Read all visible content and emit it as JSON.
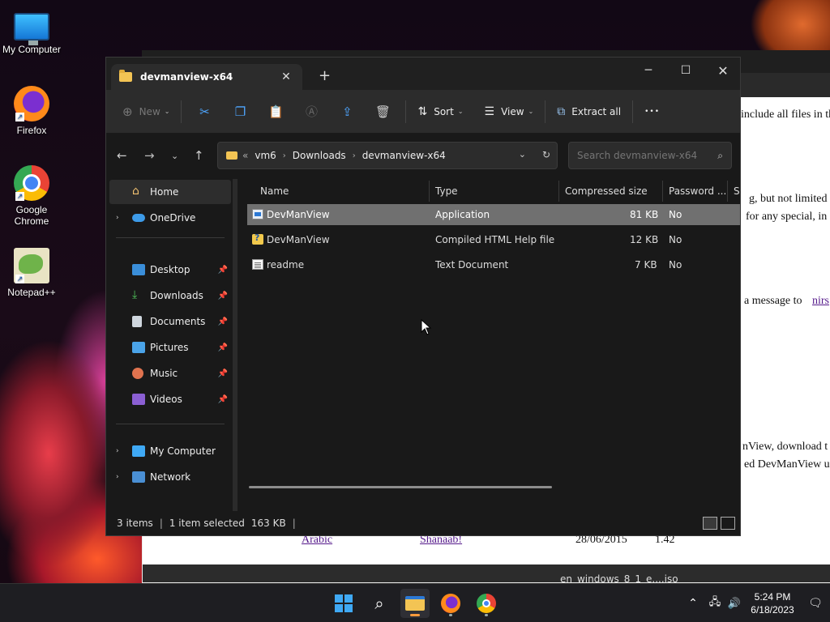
{
  "desktop": {
    "icons": [
      {
        "label": "My Computer"
      },
      {
        "label": "Firefox"
      },
      {
        "label": "Google\nChrome"
      },
      {
        "label": "Notepad++"
      }
    ]
  },
  "background_page": {
    "lines": [
      "include all files in th",
      "g, but not limited to",
      "for any special, in",
      "a message to",
      "nirs",
      "nView, download t",
      "ed DevManView u"
    ],
    "table_row": {
      "language": "Arabic",
      "translator": "Shanaab!",
      "date": "28/06/2015",
      "version": "1.42"
    },
    "taskbar_strip_text": "en_windows_8_1_e....iso"
  },
  "explorer": {
    "tab_title": "devmanview-x64",
    "toolbar": {
      "new_label": "New",
      "sort_label": "Sort",
      "view_label": "View",
      "extract_label": "Extract all",
      "more_label": "•••"
    },
    "address": {
      "overflow": "«",
      "crumbs": [
        "vm6",
        "Downloads",
        "devmanview-x64"
      ]
    },
    "search": {
      "placeholder": "Search devmanview-x64"
    },
    "sidebar": {
      "home": "Home",
      "onedrive": "OneDrive",
      "desktop": "Desktop",
      "downloads": "Downloads",
      "documents": "Documents",
      "pictures": "Pictures",
      "music": "Music",
      "videos": "Videos",
      "mycomputer": "My Computer",
      "network": "Network"
    },
    "columns": {
      "name": "Name",
      "type": "Type",
      "compressed": "Compressed size",
      "password": "Password ...",
      "size": "Si"
    },
    "files": [
      {
        "name": "DevManView",
        "type": "Application",
        "size": "81 KB",
        "password": "No"
      },
      {
        "name": "DevManView",
        "type": "Compiled HTML Help file",
        "size": "12 KB",
        "password": "No"
      },
      {
        "name": "readme",
        "type": "Text Document",
        "size": "7 KB",
        "password": "No"
      }
    ],
    "status": {
      "items": "3 items",
      "selected": "1 item selected",
      "selected_size": "163 KB"
    }
  },
  "taskbar": {
    "time": "5:24 PM",
    "date": "6/18/2023"
  }
}
